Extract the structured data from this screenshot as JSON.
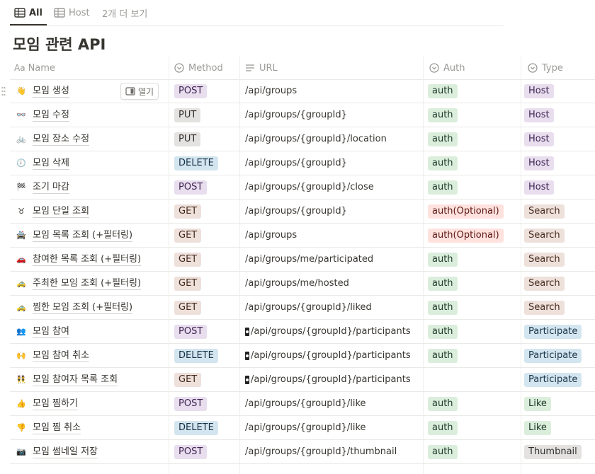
{
  "tabs": [
    {
      "label": "All"
    },
    {
      "label": "Host"
    },
    {
      "label": "2개 더 보기"
    }
  ],
  "page_title": "모임 관련 API",
  "columns": {
    "name": "Name",
    "method": "Method",
    "url": "URL",
    "auth": "Auth",
    "type": "Type"
  },
  "open_label": "열기",
  "rows": [
    {
      "emoji": "👋",
      "name": "모임 생성",
      "method": "POST",
      "url": "/api/groups",
      "auth": "auth",
      "type": "Host"
    },
    {
      "emoji": "👓",
      "name": "모임 수정",
      "method": "PUT",
      "url": "/api/groups/{groupId}",
      "auth": "auth",
      "type": "Host"
    },
    {
      "emoji": "🚲",
      "name": "모임 장소 수정",
      "method": "PUT",
      "url": "/api/groups/{groupId}/location",
      "auth": "auth",
      "type": "Host"
    },
    {
      "emoji": "🕖",
      "name": "모임 삭제",
      "method": "DELETE",
      "url": "/api/groups/{groupId}",
      "auth": "auth",
      "type": "Host"
    },
    {
      "emoji": "🏁",
      "name": "조기 마감",
      "method": "POST",
      "url": "/api/groups/{groupId}/close",
      "auth": "auth",
      "type": "Host"
    },
    {
      "emoji": "♉",
      "name": "모임 단일 조회",
      "method": "GET",
      "url": "/api/groups/{groupId}",
      "auth": "auth(Optional)",
      "type": "Search"
    },
    {
      "emoji": "🚔",
      "name": "모임 목록 조회 (+필터링)",
      "method": "GET",
      "url": "/api/groups",
      "auth": "auth(Optional)",
      "type": "Search"
    },
    {
      "emoji": "🚗",
      "name": "참여한 목록 조회 (+필터링)",
      "method": "GET",
      "url": "/api/groups/me/participated",
      "auth": "auth",
      "type": "Search"
    },
    {
      "emoji": "🚕",
      "name": "주최한 모임 조회 (+필터링)",
      "method": "GET",
      "url": "/api/groups/me/hosted",
      "auth": "auth",
      "type": "Search"
    },
    {
      "emoji": "🚕",
      "name": "찜한 모임 조회 (+필터링)",
      "method": "GET",
      "url": "/api/groups/{groupId}/liked",
      "auth": "auth",
      "type": "Search"
    },
    {
      "emoji": "👥",
      "name": "모임 참여",
      "method": "POST",
      "url": "/api/groups/{groupId}/participants",
      "auth": "auth",
      "type": "Participate",
      "url_icon": true
    },
    {
      "emoji": "🙌",
      "name": "모임 참여 취소",
      "method": "DELETE",
      "url": "/api/groups/{groupId}/participants",
      "auth": "auth",
      "type": "Participate",
      "url_icon": true
    },
    {
      "emoji": "👯",
      "name": "모임 참여자 목록 조회",
      "method": "GET",
      "url": "/api/groups/{groupId}/participants",
      "auth": "",
      "type": "Participate",
      "url_icon": true
    },
    {
      "emoji": "👍",
      "name": "모임 찜하기",
      "method": "POST",
      "url": "/api/groups/{groupId}/like",
      "auth": "auth",
      "type": "Like"
    },
    {
      "emoji": "👎",
      "name": "모임 찜 취소",
      "method": "DELETE",
      "url": "/api/groups/{groupId}/like",
      "auth": "auth",
      "type": "Like"
    },
    {
      "emoji": "📷",
      "name": "모임 썸네일 저장",
      "method": "POST",
      "url": "/api/groups/{groupId}/thumbnail",
      "auth": "auth",
      "type": "Thumbnail"
    }
  ]
}
